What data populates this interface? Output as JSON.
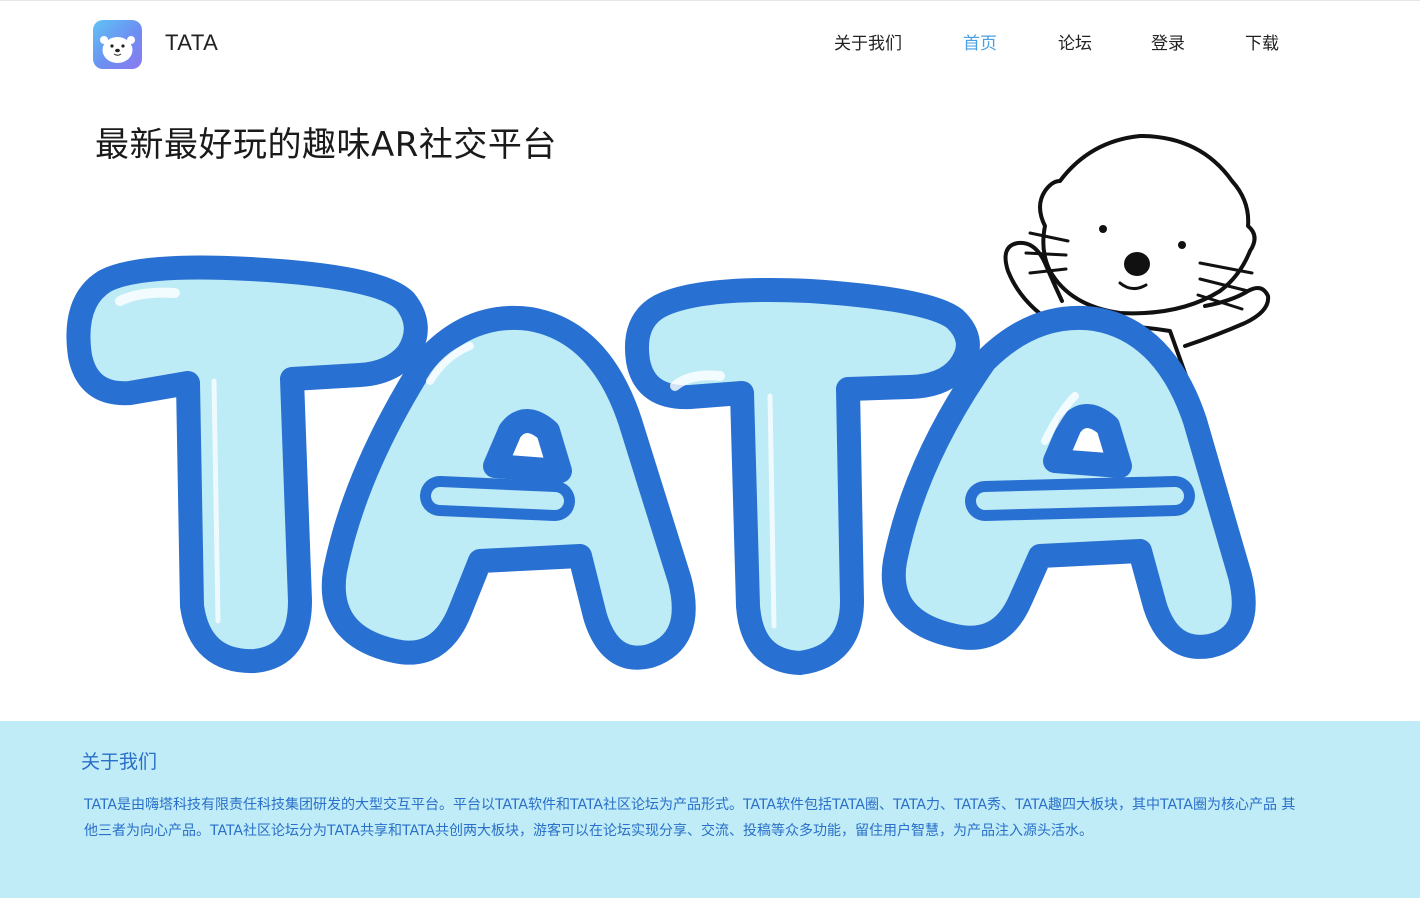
{
  "header": {
    "brand_name": "TATA",
    "logo_icon": "otter-logo-icon",
    "nav": [
      {
        "label": "关于我们",
        "active": false
      },
      {
        "label": "首页",
        "active": true
      },
      {
        "label": "论坛",
        "active": false
      },
      {
        "label": "登录",
        "active": false
      },
      {
        "label": "下载",
        "active": false
      }
    ]
  },
  "hero": {
    "title": "最新最好玩的趣味AR社交平台",
    "logo_text": "TATA",
    "mascot_icon": "otter-mascot-icon"
  },
  "about": {
    "title": "关于我们",
    "text": "TATA是由嗨塔科技有限责任科技集团研发的大型交互平台。平台以TATA软件和TATA社区论坛为产品形式。TATA软件包括TATA圈、TATA力、TATA秀、TATA趣四大板块，其中TATA圈为核心产品 其他三者为向心产品。TATA社区论坛分为TATA共享和TATA共创两大板块，游客可以在论坛实现分享、交流、投稿等众多功能，留住用户智慧，为产品注入源头活水。"
  },
  "colors": {
    "accent": "#4a9fe0",
    "logo_outline": "#2870d2",
    "logo_fill": "#bdebf6",
    "about_bg": "#bfecf6",
    "about_text": "#2a6fc9"
  }
}
